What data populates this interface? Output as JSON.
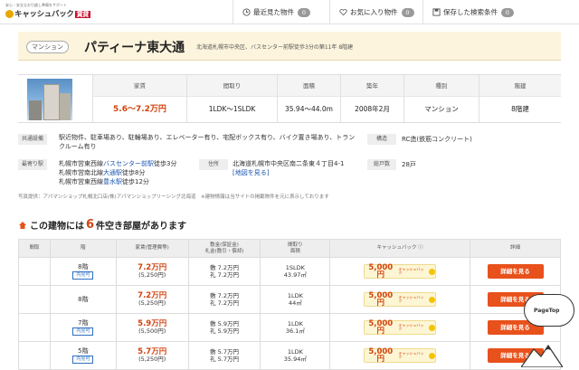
{
  "header": {
    "logo_tagline": "安心・安全なお引越し準備をサポート",
    "logo_text": "キャッシュバック",
    "logo_badge": "賃貸",
    "nav": [
      {
        "label": "最近見た物件",
        "count": "0",
        "icon": "clock-icon"
      },
      {
        "label": "お気に入り物件",
        "count": "0",
        "icon": "heart-icon"
      },
      {
        "label": "保存した検索条件",
        "count": "0",
        "icon": "save-icon"
      }
    ]
  },
  "property": {
    "type_tag": "マンション",
    "name": "パティーナ東大通",
    "address_line": "北海道札幌市中央区、バスセンター前駅徒歩3分の築11年 8階建"
  },
  "summary": {
    "headers": [
      "家賃",
      "間取り",
      "面積",
      "築年",
      "種別",
      "階建"
    ],
    "values": [
      "5.6〜7.2万円",
      "1LDK〜1SLDK",
      "35.94〜44.0m",
      "2008年2月",
      "マンション",
      "8階建"
    ]
  },
  "details": {
    "facilities_label": "共通設備",
    "facilities_value": "駅近物件、駐車場あり、駐輪場あり、エレベーター有り、宅配ボックス有り、バイク置き場あり、トランクルーム有り",
    "structure_label": "構造",
    "structure_value": "RC造(鉄筋コンクリート)",
    "station_label": "最寄り駅",
    "station_lines": [
      {
        "prefix": "札幌市営東西線",
        "link": "バスセンター前駅",
        "suffix": "徒歩3分"
      },
      {
        "prefix": "札幌市営南北線",
        "link": "大通駅",
        "suffix": "徒歩8分"
      },
      {
        "prefix": "札幌市営東西線",
        "link": "豊水駅",
        "suffix": "徒歩12分"
      }
    ],
    "address_label": "住所",
    "address_value": "北海道札幌市中央区南二条東４丁目4-1",
    "map_link": "[地図を見る]",
    "units_label": "総戸数",
    "units_value": "28戸"
  },
  "note": "写真提供：アパマンショップ札幌北口店(株)アパマンショップリーシング北海道　※建物情報は当サイトの掲載物件を元に表示しております",
  "vacancy": {
    "prefix": "この建物には",
    "count": "6",
    "suffix": "件空き部屋があります"
  },
  "table": {
    "headers": [
      "間取",
      "階",
      "家賃(管理費等)",
      "敷金(保証金)\n礼金(敷引・償却)",
      "間取り\n面積",
      "キャッシュバック ⓘ",
      "詳細"
    ],
    "rows": [
      {
        "floor": "8階",
        "tour": "内見可",
        "rent": "7.2万円",
        "fee": "(5,250円)",
        "deposit": "敷 7.2万円",
        "key": "礼 7.2万円",
        "layout": "1SLDK",
        "area": "43.97㎡",
        "cashback": "5,000円",
        "cb_tag": "キャッシュバック",
        "detail": "詳細を見る"
      },
      {
        "floor": "8階",
        "tour": "",
        "rent": "7.2万円",
        "fee": "(5,250円)",
        "deposit": "敷 7.2万円",
        "key": "礼 7.2万円",
        "layout": "1LDK",
        "area": "44㎡",
        "cashback": "5,000円",
        "cb_tag": "キャッシュバック",
        "detail": "詳細を見る"
      },
      {
        "floor": "7階",
        "tour": "内見可",
        "rent": "5.9万円",
        "fee": "(5,500円)",
        "deposit": "敷 5.9万円",
        "key": "礼 5.9万円",
        "layout": "1LDK",
        "area": "36.1㎡",
        "cashback": "5,000円",
        "cb_tag": "キャッシュバック",
        "detail": "詳細を見る"
      },
      {
        "floor": "5階",
        "tour": "内見可",
        "rent": "5.7万円",
        "fee": "(5,250円)",
        "deposit": "敷 5.7万円",
        "key": "礼 5.7万円",
        "layout": "1LDK",
        "area": "35.94㎡",
        "cashback": "5,000円",
        "cb_tag": "キャッシュバック",
        "detail": "詳細を見る"
      }
    ]
  },
  "pagetop": "PageTop"
}
